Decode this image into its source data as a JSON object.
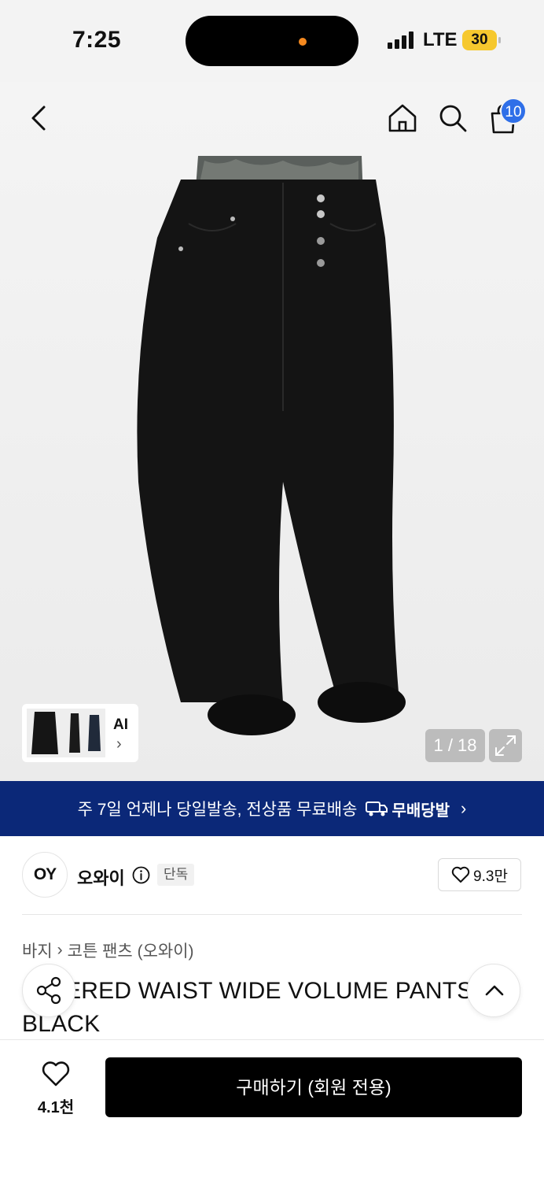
{
  "status_bar": {
    "time": "7:25",
    "network": "LTE",
    "battery": "30"
  },
  "header": {
    "cart_count": "10"
  },
  "gallery": {
    "counter": "1 / 18",
    "ai_label": "AI",
    "ai_chevron": "›"
  },
  "banner": {
    "text": "주 7일 언제나 당일발송, 전상품 무료배송",
    "logo_text": "무배당발",
    "chevron": "›"
  },
  "brand": {
    "logo": "OY",
    "name": "오와이",
    "tag": "단독",
    "likes": "9.3만"
  },
  "product": {
    "breadcrumb": [
      "바지",
      "코튼 팬츠 (오와이)"
    ],
    "breadcrumb_sep": "›",
    "title": "LAYERED WAIST WIDE VOLUME PANTS BLACK"
  },
  "bottom_bar": {
    "wish_count": "4.1천",
    "buy_label": "구매하기 (회원 전용)"
  },
  "colors": {
    "banner_bg": "#0b2878",
    "badge": "#2f6fe8",
    "battery": "#f6c82e",
    "buy_bg": "#000000"
  }
}
